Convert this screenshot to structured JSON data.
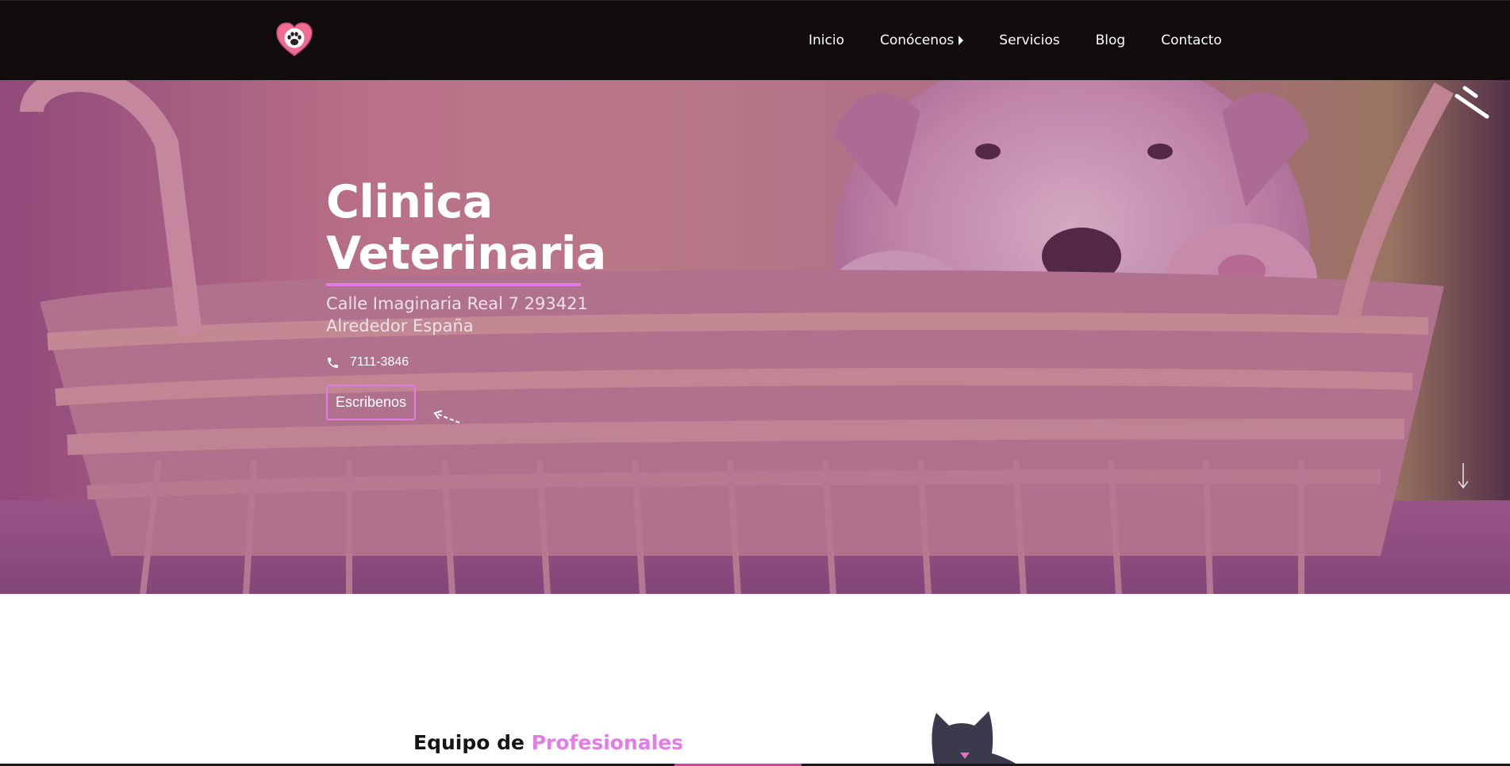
{
  "nav": {
    "logo_icon": "heart-paw-icon",
    "items": [
      {
        "label": "Inicio",
        "has_submenu": false
      },
      {
        "label": "Conócenos",
        "has_submenu": true
      },
      {
        "label": "Servicios",
        "has_submenu": false
      },
      {
        "label": "Blog",
        "has_submenu": false
      },
      {
        "label": "Contacto",
        "has_submenu": false
      }
    ]
  },
  "hero": {
    "title": "Clinica\nVeterinaria",
    "address_line1": "Calle Imaginaria Real 7 293421",
    "address_line2": "Alrededor España",
    "phone_icon": "phone-icon",
    "phone": "7111-3846",
    "cta_label": "Escribenos",
    "background": "puppy-in-wicker-basket-photo"
  },
  "section": {
    "heading_part1": "Equipo de",
    "heading_part2": "Profesionales"
  },
  "colors": {
    "accent": "#e27de6",
    "nav_bg": "#120c0c",
    "heading_text": "#151515"
  }
}
